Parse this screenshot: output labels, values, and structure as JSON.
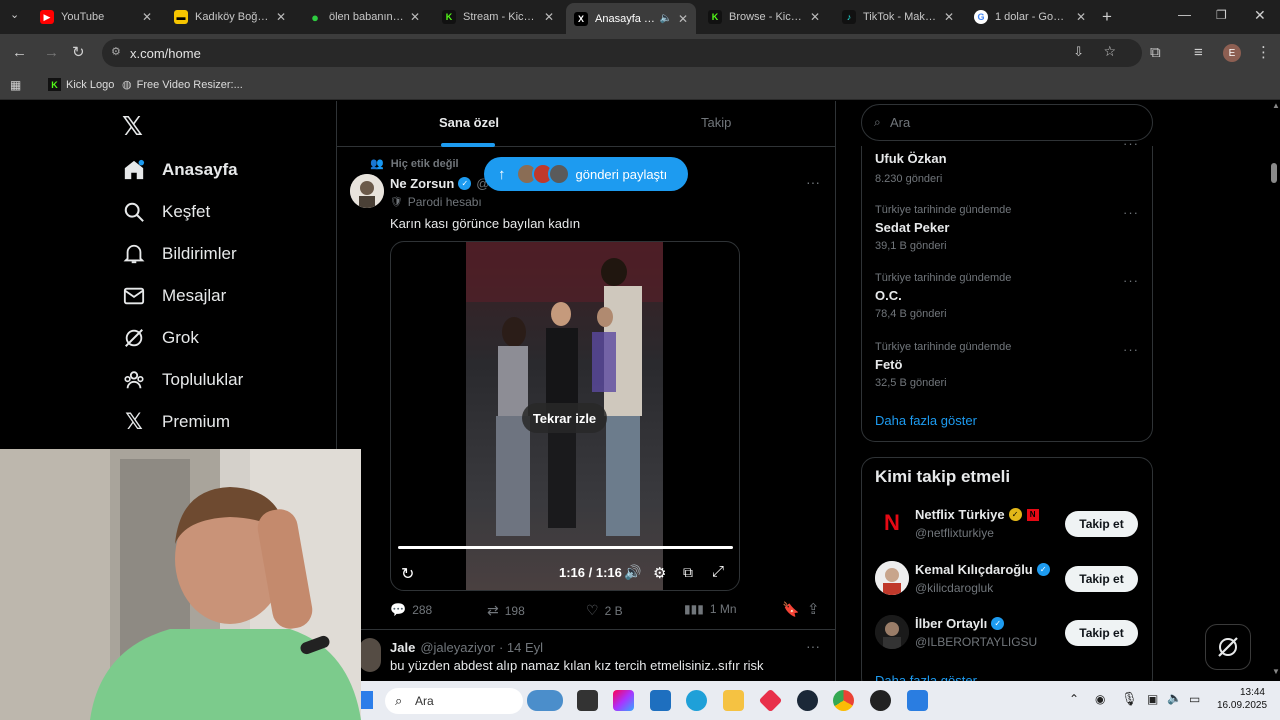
{
  "browser": {
    "tabs": [
      {
        "label": "YouTube",
        "color": "#ff0000"
      },
      {
        "label": "Kadıköy Boğası (",
        "color": "#f6c500"
      },
      {
        "label": "ölen babanın kay",
        "color": "#2ecc40"
      },
      {
        "label": "Stream - Kick Da",
        "color": "#53fc18"
      },
      {
        "label": "Anasayfa / X",
        "color": "#ffffff"
      },
      {
        "label": "Browse - Kick St",
        "color": "#53fc18"
      },
      {
        "label": "TikTok - Make Yo",
        "color": "#111111"
      },
      {
        "label": "1 dolar - Google",
        "color": "#4285f4"
      }
    ],
    "url": "x.com/home",
    "bookmarks": [
      "Kick Logo",
      "Free Video Resizer:..."
    ],
    "profile_initial": "E"
  },
  "nav": {
    "items": [
      {
        "label": "Anasayfa",
        "icon": "home-icon"
      },
      {
        "label": "Keşfet",
        "icon": "search-icon"
      },
      {
        "label": "Bildirimler",
        "icon": "bell-icon"
      },
      {
        "label": "Mesajlar",
        "icon": "mail-icon"
      },
      {
        "label": "Grok",
        "icon": "grok-icon"
      },
      {
        "label": "Topluluklar",
        "icon": "people-icon"
      },
      {
        "label": "Premium",
        "icon": "x-logo-icon"
      }
    ]
  },
  "feed": {
    "tabs": [
      "Sana özel",
      "Takip"
    ],
    "reposted_by": "Hiç etik değil",
    "share_pill": "gönderi paylaştı",
    "post": {
      "name": "Ne Zorsun",
      "handle": "@Y",
      "label": "Parodi hesabı",
      "text": "Karın kası görünce bayılan kadın",
      "replay": "Tekrar izle",
      "time": "1:16 / 1:16",
      "stats": {
        "replies": "288",
        "reposts": "198",
        "likes": "2 B",
        "views": "1 Mn"
      }
    },
    "next_post": {
      "name": "Jale",
      "handle": "@jaleyaziyor",
      "date": "· 14 Eyl",
      "text": "bu yüzden abdest alıp namaz kılan kız tercih etmelisiniz..sıfır risk"
    }
  },
  "right": {
    "search_placeholder": "Ara",
    "trends": [
      {
        "context": "Türkiye tarihinde gündemde",
        "name": "Ufuk Özkan",
        "count": "8.230 gönderi"
      },
      {
        "context": "Türkiye tarihinde gündemde",
        "name": "Sedat Peker",
        "count": "39,1 B gönderi"
      },
      {
        "context": "Türkiye tarihinde gündemde",
        "name": "O.C.",
        "count": "78,4 B gönderi"
      },
      {
        "context": "Türkiye tarihinde gündemde",
        "name": "Fetö",
        "count": "32,5 B gönderi"
      }
    ],
    "show_more": "Daha fazla göster",
    "who_to_follow_title": "Kimi takip etmeli",
    "suggestions": [
      {
        "name": "Netflix Türkiye",
        "handle": "@netflixturkiye"
      },
      {
        "name": "Kemal Kılıçdaroğlu",
        "handle": "@kilicdarogluk"
      },
      {
        "name": "İlber Ortaylı",
        "handle": "@ILBERORTAYLIGSU"
      }
    ],
    "follow_label": "Takip et",
    "show_more_bottom": "Daha fazla göster"
  },
  "taskbar": {
    "search": "Ara",
    "time": "13:44",
    "date": "16.09.2025"
  },
  "colors": {
    "accent": "#1d9bf0",
    "background": "#000000"
  }
}
